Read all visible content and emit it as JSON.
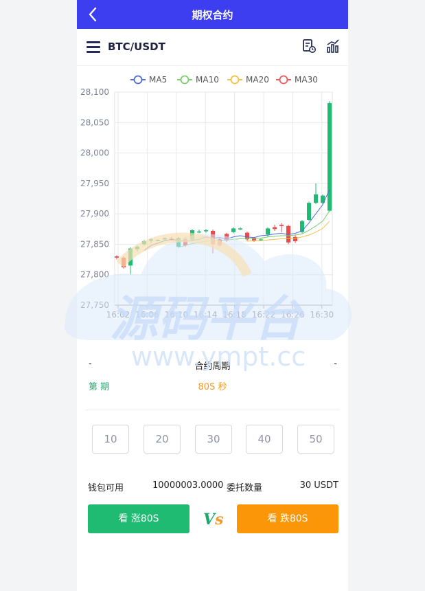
{
  "topbar": {
    "title": "期权合约"
  },
  "header": {
    "pair": "BTC/USDT"
  },
  "chart_data": {
    "type": "candlestick",
    "legend": [
      "MA5",
      "MA10",
      "MA20",
      "MA30"
    ],
    "legend_colors": [
      "#4f6bd8",
      "#7bcf6e",
      "#f2c04a",
      "#ef5a5a"
    ],
    "y_ticks": [
      "28,100",
      "28,050",
      "28,000",
      "27,950",
      "27,900",
      "27,850",
      "27,800",
      "27,750"
    ],
    "x_ticks": [
      "16:02",
      "16:06",
      "16:10",
      "16:14",
      "16:18",
      "16:22",
      "16:26",
      "16:30"
    ],
    "ylim": [
      27750,
      28100
    ],
    "up_color": "#1fbb72",
    "down_color": "#f04848",
    "candles": [
      {
        "o": 27830,
        "c": 27828,
        "h": 27832,
        "l": 27825
      },
      {
        "o": 27828,
        "c": 27812,
        "h": 27830,
        "l": 27810
      },
      {
        "o": 27815,
        "c": 27843,
        "h": 27845,
        "l": 27800
      },
      {
        "o": 27842,
        "c": 27846,
        "h": 27848,
        "l": 27838
      },
      {
        "o": 27850,
        "c": 27855,
        "h": 27857,
        "l": 27848
      },
      {
        "o": 27856,
        "c": 27858,
        "h": 27860,
        "l": 27852
      },
      {
        "o": 27857,
        "c": 27857,
        "h": 27858,
        "l": 27856
      },
      {
        "o": 27858,
        "c": 27860,
        "h": 27861,
        "l": 27856
      },
      {
        "o": 27859,
        "c": 27857,
        "h": 27862,
        "l": 27856
      },
      {
        "o": 27846,
        "c": 27860,
        "h": 27862,
        "l": 27844
      },
      {
        "o": 27859,
        "c": 27848,
        "h": 27862,
        "l": 27846
      },
      {
        "o": 27857,
        "c": 27873,
        "h": 27875,
        "l": 27855
      },
      {
        "o": 27870,
        "c": 27871,
        "h": 27874,
        "l": 27868
      },
      {
        "o": 27872,
        "c": 27873,
        "h": 27875,
        "l": 27869
      },
      {
        "o": 27872,
        "c": 27850,
        "h": 27874,
        "l": 27835
      },
      {
        "o": 27858,
        "c": 27848,
        "h": 27860,
        "l": 27846
      },
      {
        "o": 27867,
        "c": 27856,
        "h": 27869,
        "l": 27854
      },
      {
        "o": 27870,
        "c": 27876,
        "h": 27878,
        "l": 27868
      },
      {
        "o": 27875,
        "c": 27876,
        "h": 27878,
        "l": 27873
      },
      {
        "o": 27869,
        "c": 27858,
        "h": 27871,
        "l": 27855
      },
      {
        "o": 27860,
        "c": 27856,
        "h": 27862,
        "l": 27854
      },
      {
        "o": 27858,
        "c": 27858,
        "h": 27860,
        "l": 27855
      },
      {
        "o": 27866,
        "c": 27876,
        "h": 27878,
        "l": 27862
      },
      {
        "o": 27878,
        "c": 27875,
        "h": 27882,
        "l": 27872
      },
      {
        "o": 27882,
        "c": 27880,
        "h": 27885,
        "l": 27870
      },
      {
        "o": 27880,
        "c": 27853,
        "h": 27882,
        "l": 27850
      },
      {
        "o": 27862,
        "c": 27855,
        "h": 27866,
        "l": 27852
      },
      {
        "o": 27870,
        "c": 27888,
        "h": 27890,
        "l": 27868
      },
      {
        "o": 27890,
        "c": 27918,
        "h": 27920,
        "l": 27888
      },
      {
        "o": 27918,
        "c": 27932,
        "h": 27950,
        "l": 27916
      },
      {
        "o": 27918,
        "c": 27930,
        "h": 27932,
        "l": 27916
      },
      {
        "o": 27905,
        "c": 28082,
        "h": 28085,
        "l": 27903
      }
    ],
    "ma5": [
      null,
      null,
      null,
      null,
      27840,
      27848,
      27852,
      27856,
      27858,
      27856,
      27855,
      27856,
      27858,
      27862,
      27860,
      27861,
      27859,
      27862,
      27864,
      27862,
      27861,
      27864,
      27865,
      27867,
      27868,
      27866,
      27868,
      27872,
      27885,
      27900,
      27915,
      27940
    ],
    "ma10": [
      null,
      null,
      null,
      null,
      null,
      null,
      null,
      null,
      null,
      27845,
      27848,
      27851,
      27853,
      27855,
      27856,
      27856,
      27857,
      27858,
      27859,
      27860,
      27860,
      27860,
      27862,
      27863,
      27864,
      27864,
      27865,
      27867,
      27873,
      27880,
      27888,
      27905
    ],
    "ma20": [
      null,
      null,
      null,
      null,
      null,
      null,
      null,
      null,
      null,
      null,
      null,
      null,
      null,
      null,
      null,
      null,
      null,
      null,
      null,
      27855,
      27856,
      27856,
      27857,
      27858,
      27859,
      27859,
      27860,
      27862,
      27865,
      27870,
      27876,
      27888
    ],
    "ma30": []
  },
  "period": {
    "left": "-",
    "center": "合约周期",
    "right": "-"
  },
  "info": {
    "left": "第 期",
    "center": "80S 秒"
  },
  "quantities": [
    "10",
    "20",
    "30",
    "40",
    "50"
  ],
  "wallet": {
    "label": "钱包可用",
    "value": "10000003.0000",
    "entrust_label": "委托数量",
    "entrust_value": "30 USDT"
  },
  "trade": {
    "up_label": "看 涨80S",
    "down_label": "看 跌80S",
    "vs_v": "V",
    "vs_s": "s"
  },
  "watermark": {
    "cn": "源码平台",
    "url": "www.ympt.cc"
  }
}
